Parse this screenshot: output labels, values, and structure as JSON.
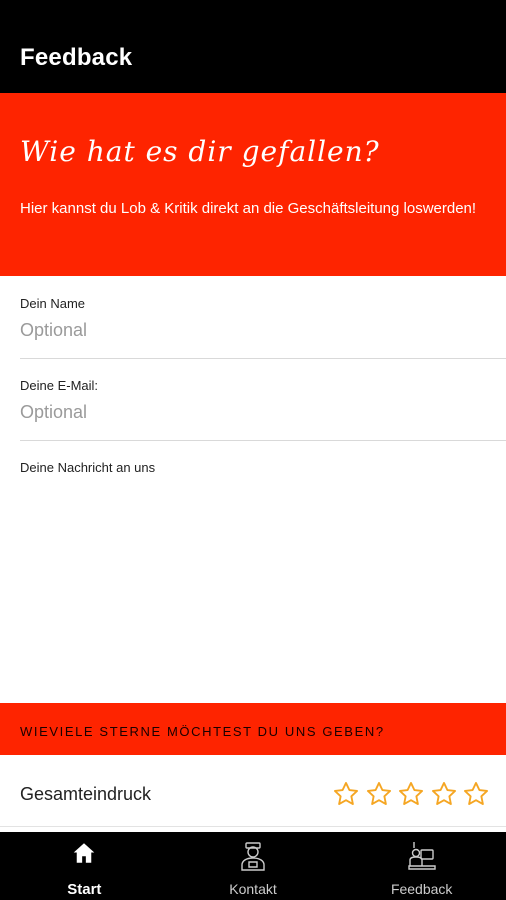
{
  "app_bar": {
    "title": "Feedback"
  },
  "hero": {
    "headline": "Wie hat es dir gefallen?",
    "subtitle": "Hier kannst du Lob & Kritik direkt an die Geschäftsleitung loswerden!"
  },
  "form": {
    "name": {
      "label": "Dein Name",
      "placeholder": "Optional"
    },
    "email": {
      "label": "Deine E-Mail:",
      "placeholder": "Optional"
    },
    "message": {
      "label": "Deine Nachricht an uns"
    }
  },
  "stars_banner": {
    "text": "WIEVIELE STERNE MÖCHTEST DU UNS GEBEN?"
  },
  "rating": {
    "label": "Gesamteindruck",
    "max_stars": 5,
    "selected": 0,
    "star_color": "#f5a623"
  },
  "bottom_nav": {
    "items": [
      {
        "label": "Start",
        "icon": "home-icon",
        "active": true
      },
      {
        "label": "Kontakt",
        "icon": "person-icon",
        "active": false
      },
      {
        "label": "Feedback",
        "icon": "feedback-desk-icon",
        "active": false
      }
    ]
  },
  "colors": {
    "accent": "#fe2400",
    "bar": "#000000"
  }
}
